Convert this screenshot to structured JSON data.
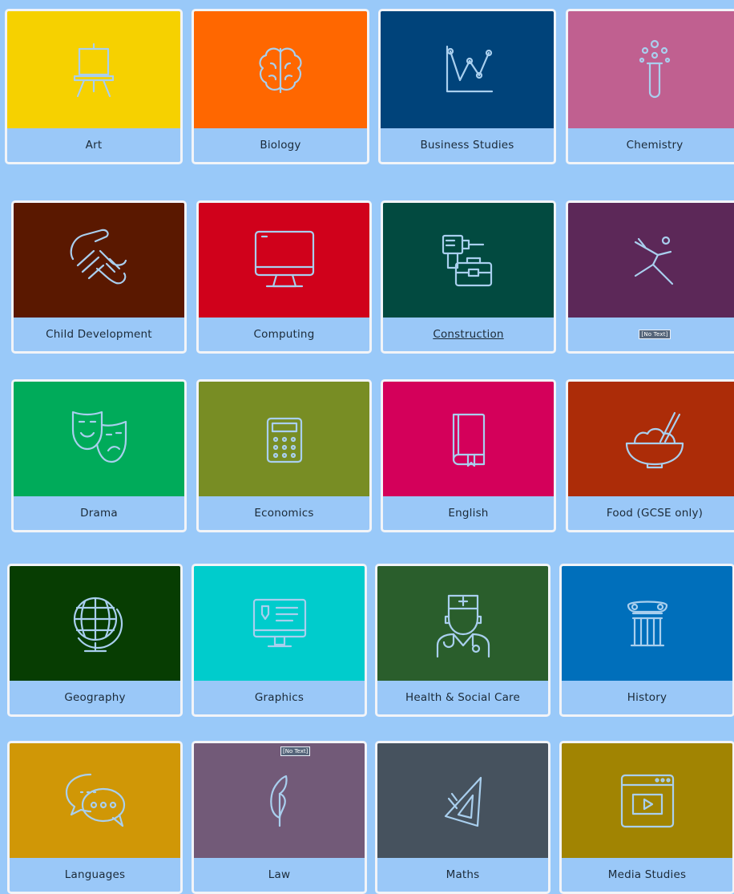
{
  "subjects": [
    {
      "label": "Art",
      "color": "#f6d100",
      "icon": "easel-icon"
    },
    {
      "label": "Biology",
      "color": "#ff6700",
      "icon": "brain-icon"
    },
    {
      "label": "Business Studies",
      "color": "#00437a",
      "icon": "line-chart-icon"
    },
    {
      "label": "Chemistry",
      "color": "#c06090",
      "icon": "test-tube-icon"
    },
    {
      "label": "Child Development",
      "color": "#5a1800",
      "icon": "hands-icon"
    },
    {
      "label": "Computing",
      "color": "#d0011b",
      "icon": "monitor-icon"
    },
    {
      "label": "Construction",
      "color": "#024a40",
      "icon": "drill-toolbox-icon"
    },
    {
      "label": "",
      "badge": "[No Text]",
      "color": "#5c2858",
      "icon": "dancer-icon"
    },
    {
      "label": "Drama",
      "color": "#00ab5a",
      "icon": "theatre-masks-icon"
    },
    {
      "label": "Economics",
      "color": "#788d24",
      "icon": "calculator-icon"
    },
    {
      "label": "English",
      "color": "#d4005a",
      "icon": "book-icon"
    },
    {
      "label": "Food (GCSE only)",
      "color": "#ac2c08",
      "icon": "food-bowl-icon"
    },
    {
      "label": "Geography",
      "color": "#073d02",
      "icon": "globe-icon"
    },
    {
      "label": "Graphics",
      "color": "#00cccc",
      "icon": "design-monitor-icon"
    },
    {
      "label": "Health & Social Care",
      "color": "#2a5e2c",
      "icon": "doctor-icon"
    },
    {
      "label": "History",
      "color": "#006fbb",
      "icon": "column-icon"
    },
    {
      "label": "Languages",
      "color": "#d09706",
      "icon": "speech-bubbles-icon"
    },
    {
      "label": "Law",
      "badge": "[No Text]",
      "color": "#725a78",
      "icon": "quill-icon"
    },
    {
      "label": "Maths",
      "color": "#46525e",
      "icon": "set-square-icon"
    },
    {
      "label": "Media Studies",
      "color": "#a18402",
      "icon": "video-player-icon"
    }
  ]
}
